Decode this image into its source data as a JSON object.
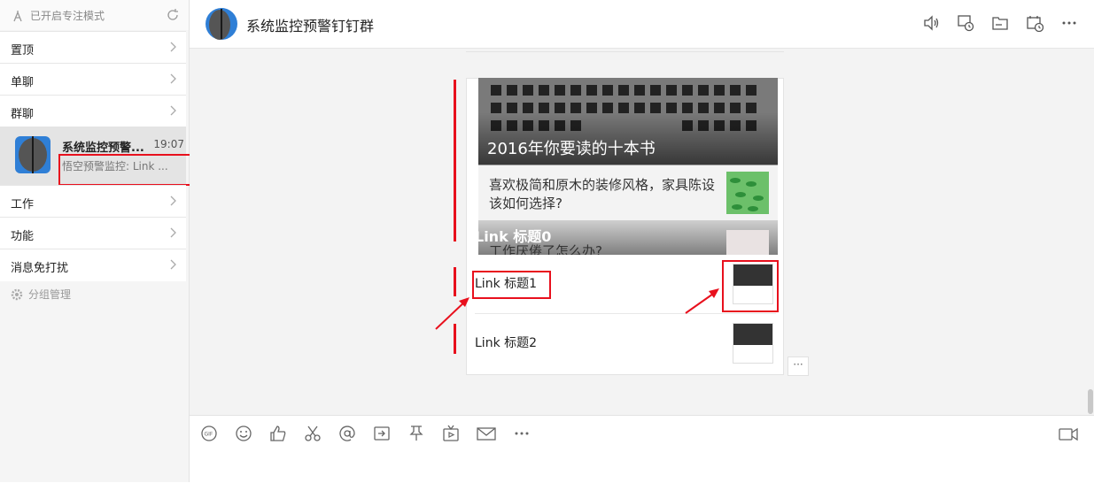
{
  "sidebar": {
    "focus_mode": "已开启专注模式",
    "sections": [
      {
        "label": "置顶"
      },
      {
        "label": "单聊"
      },
      {
        "label": "群聊"
      }
    ],
    "active_chat": {
      "name": "系统监控预警...",
      "time": "19:07",
      "preview": "悟空预警监控: Link ..."
    },
    "sections2": [
      {
        "label": "工作"
      },
      {
        "label": "功能"
      },
      {
        "label": "消息免打扰"
      }
    ],
    "group_manage": "分组管理"
  },
  "header": {
    "title": "系统监控预警钉钉群"
  },
  "message": {
    "hero_title": "2016年你要读的十本书",
    "item_a": "喜欢极简和原木的装修风格，家具陈设该如何选择?",
    "link0": "Link 标题0",
    "item_b": "工作厌倦了怎么办?",
    "link1": "Link 标题1",
    "link2": "Link 标题2"
  },
  "more_button": "···",
  "colors": {
    "annotation_red": "#e8101d",
    "sidebar_bg": "#f5f5f5",
    "chat_bg": "#f3f3f3",
    "active_item": "#e4e4e4"
  },
  "icons": {
    "header": [
      "speaker-icon",
      "chat-history-icon",
      "folder-icon",
      "calendar-icon",
      "more-icon"
    ],
    "toolbar": [
      "gif-icon",
      "emoji-icon",
      "thumbs-up-icon",
      "scissors-icon",
      "at-icon",
      "forward-icon",
      "pin-icon",
      "live-icon",
      "mail-icon",
      "more-icon"
    ],
    "video": "video-call-icon"
  }
}
